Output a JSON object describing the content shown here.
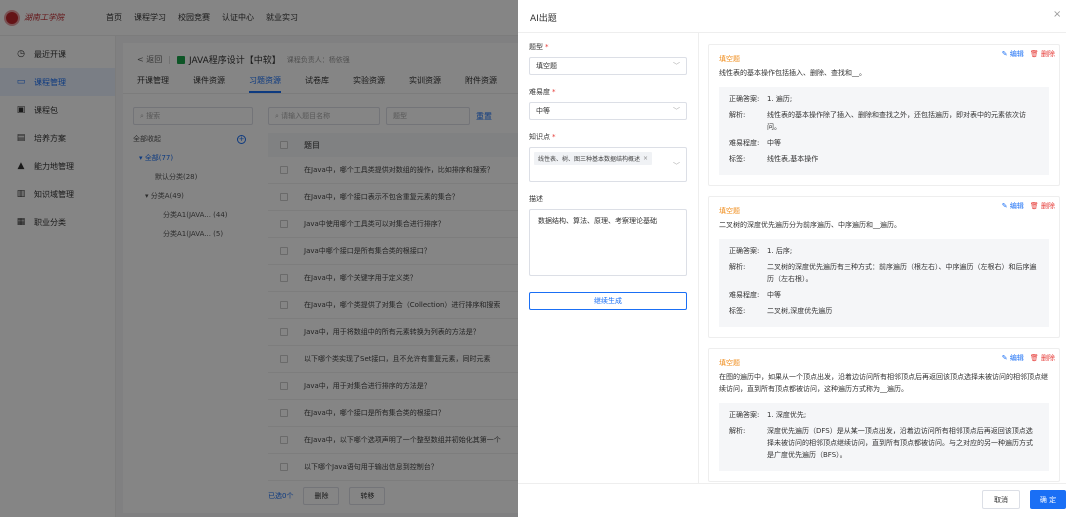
{
  "header": {
    "logo_text": "湖南工学院",
    "nav": [
      "首页",
      "课程学习",
      "校园竞赛",
      "认证中心",
      "就业实习"
    ]
  },
  "sidebar": {
    "items": [
      {
        "label": "最近开课",
        "icon": "clock-icon",
        "glyph": "◷"
      },
      {
        "label": "课程管理",
        "icon": "monitor-icon",
        "glyph": "▭",
        "active": true
      },
      {
        "label": "课程包",
        "icon": "package-icon",
        "glyph": "▣"
      },
      {
        "label": "培养方案",
        "icon": "document-icon",
        "glyph": "▤"
      },
      {
        "label": "能力地管理",
        "icon": "triangle-icon",
        "glyph": "▲"
      },
      {
        "label": "知识域管理",
        "icon": "book-icon",
        "glyph": "▥"
      },
      {
        "label": "职业分类",
        "icon": "grid-icon",
        "glyph": "▦"
      }
    ]
  },
  "breadcrumb": {
    "back": "< 返回",
    "course": "JAVA程序设计【中软】",
    "owner": "课程负责人：杨依强"
  },
  "tabs": [
    "开课管理",
    "课件资源",
    "习题资源",
    "试卷库",
    "实验资源",
    "实训资源",
    "附件资源"
  ],
  "tree": {
    "search_placeholder": "搜索",
    "title": "全部收起",
    "rows": [
      "▾ 全部(77)",
      "默认分类(28)",
      "▾ 分类A(49)",
      "分类A1(JAVA... (44)",
      "分类A1(JAVA... (5)"
    ]
  },
  "question_list": {
    "search_placeholder": "请输入题目名称",
    "type_placeholder": "题型",
    "reset": "重置",
    "header": "题目",
    "rows": [
      "在Java中，哪个工具类提供对数组的操作，比如排序和搜索？",
      "在Java中，哪个接口表示不包含重复元素的集合？",
      "Java中使用哪个工具类可以对集合进行排序？",
      "Java中哪个接口是所有集合类的根接口？",
      "在Java中，哪个关键字用于定义类？",
      "在Java中，哪个类提供了对集合（Collection）进行排序和搜索",
      "Java中，用于将数组中的所有元素转换为列表的方法是？",
      "以下哪个类实现了Set接口，且不允许有重复元素，同时元素",
      "Java中，用于对集合进行排序的方法是？",
      "在Java中，哪个接口是所有集合类的根接口？",
      "在Java中，以下哪个选项声明了一个整型数组并初始化其第一个",
      "以下哪个Java语句用于输出信息到控制台？"
    ],
    "selected_count": "已选0个",
    "delete_label": "删除",
    "move_label": "转移"
  },
  "drawer": {
    "title": "AI出题",
    "close_glyph": "×",
    "form": {
      "type_label": "题型",
      "type_value": "填空题",
      "difficulty_label": "难易度",
      "difficulty_value": "中等",
      "knowledge_label": "知识点",
      "knowledge_tag": "线性表、树、图三种基本数据结构概述",
      "desc_label": "描述",
      "desc_value": "数据结构、算法、原理、考察理论基础",
      "generate_label": "继续生成"
    },
    "cards": [
      {
        "type": "填空题",
        "stem": "线性表的基本操作包括插入、删除、查找和__。",
        "answer": "1. 遍历;",
        "analysis": "线性表的基本操作除了插入、删除和查找之外，还包括遍历，即对表中的元素依次访问。",
        "difficulty": "中等",
        "tags": "线性表,基本操作"
      },
      {
        "type": "填空题",
        "stem": "二叉树的深度优先遍历分为前序遍历、中序遍历和__遍历。",
        "answer": "1. 后序;",
        "analysis": "二叉树的深度优先遍历有三种方式：前序遍历（根左右）、中序遍历（左根右）和后序遍历（左右根）。",
        "difficulty": "中等",
        "tags": "二叉树,深度优先遍历"
      },
      {
        "type": "填空题",
        "stem": "在图的遍历中，如果从一个顶点出发，沿着边访问所有相邻顶点后再返回该顶点选择未被访问的相邻顶点继续访问，直到所有顶点都被访问，这种遍历方式称为__遍历。",
        "answer": "1. 深度优先;",
        "analysis": "深度优先遍历（DFS）是从某一顶点出发，沿着边访问所有相邻顶点后再返回该顶点选择未被访问的相邻顶点继续访问，直到所有顶点都被访问。与之对应的另一种遍历方式是广度优先遍历（BFS）。",
        "difficulty": "中等",
        "tags": ""
      }
    ],
    "labels": {
      "answer": "正确答案:",
      "analysis": "解析:",
      "difficulty": "难易程度:",
      "tags": "标签:",
      "edit": "编辑",
      "delete": "删除"
    },
    "cancel_label": "取消",
    "ok_label": "确 定"
  },
  "colors": {
    "accent": "#1a6ff5",
    "danger": "#e53935",
    "type_badge": "#f08c1a",
    "brand": "#c0272d"
  }
}
